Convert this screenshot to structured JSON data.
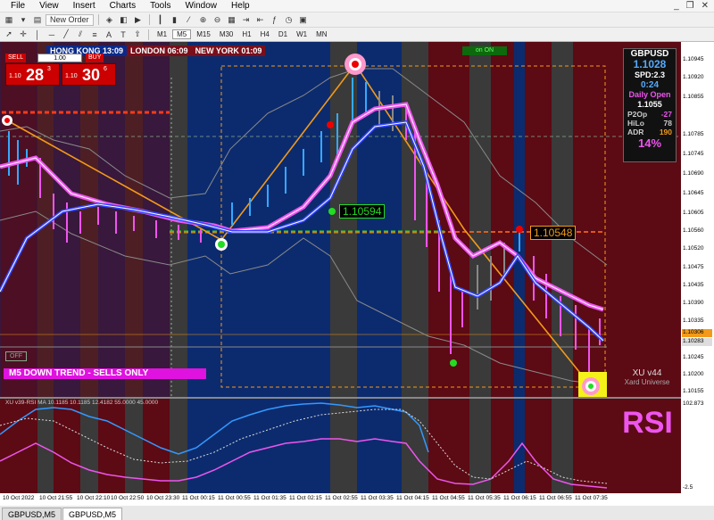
{
  "menu": [
    "File",
    "View",
    "Insert",
    "Charts",
    "Tools",
    "Window",
    "Help"
  ],
  "toolbar": {
    "new_order_label": "New Order",
    "timeframes": [
      "M1",
      "M5",
      "M15",
      "M30",
      "H1",
      "H4",
      "D1",
      "W1",
      "MN"
    ],
    "active_timeframe": "M5"
  },
  "sessions": [
    {
      "label": "HONG KONG 13:09",
      "color": "#0a2a8a"
    },
    {
      "label": "LONDON 06:09",
      "color": "#7a0f1a"
    },
    {
      "label": "NEW YORK 01:09",
      "color": "#7a0f1a"
    }
  ],
  "trade_panel": {
    "sell_label": "SELL",
    "buy_label": "BUY",
    "lot": "1.00",
    "sell_prefix": "1.10",
    "sell_big": "28",
    "sell_sup": "3",
    "buy_prefix": "1.10",
    "buy_big": "30",
    "buy_sup": "6"
  },
  "info_panel": {
    "symbol": "GBPUSD",
    "price": "1.1028",
    "spd": "SPD:2.3",
    "timer": "0:24",
    "daily_open_label": "Daily Open",
    "daily_open": "1.1055",
    "p2op_label": "P2Op",
    "p2op": "-27",
    "hilo_label": "HiLo",
    "hilo": "78",
    "adr_label": "ADR",
    "adr": "190",
    "pct": "14%"
  },
  "buttons": {
    "on_label": "on ON",
    "off_label": "OFF"
  },
  "trend_banner": "M5  DOWN TREND - SELLS ONLY",
  "price_labels": {
    "green": "1.10594",
    "orange": "1.10548"
  },
  "watermark": {
    "line1": "XU v44",
    "line2": "Xard Universe"
  },
  "price_axis": [
    "1.10945",
    "1.10920",
    "1.10855",
    "1.10785",
    "1.10745",
    "1.10690",
    "1.10645",
    "1.10605",
    "1.10560",
    "1.10520",
    "1.10475",
    "1.10435",
    "1.10390",
    "1.10335",
    "1.10245",
    "1.10200",
    "1.10155"
  ],
  "price_boxes": {
    "bid": "1.10306",
    "ask": "1.10283"
  },
  "rsi_header": "XU v39-RSI MA 10.1185 10.1185 12.4182 55.0000 45.0000",
  "rsi_axis_top": "102.873",
  "rsi_axis_bottom": "-2.5",
  "rsi_label": "RSI",
  "time_axis": [
    "10 Oct 2022",
    "10 Oct 21:55",
    "10 Oct 22:10",
    "10 Oct 22:50",
    "10 Oct 23:30",
    "11 Oct 00:15",
    "11 Oct 00:55",
    "11 Oct 01:35",
    "11 Oct 02:15",
    "11 Oct 02:55",
    "11 Oct 03:35",
    "11 Oct 04:15",
    "11 Oct 04:55",
    "11 Oct 05:35",
    "11 Oct 06:15",
    "11 Oct 06:55",
    "11 Oct 07:35"
  ],
  "tabs": [
    "GBPUSD,M5",
    "GBPUSD,M5"
  ],
  "colors": {
    "blue_session": "#0c2b6e",
    "red_session": "#5c0a14",
    "gray_session": "#3a3a3a",
    "pink_ma": "#ee55ee",
    "blue_ma": "#3344ff",
    "orange": "#f39a1a",
    "green": "#22dd22"
  }
}
